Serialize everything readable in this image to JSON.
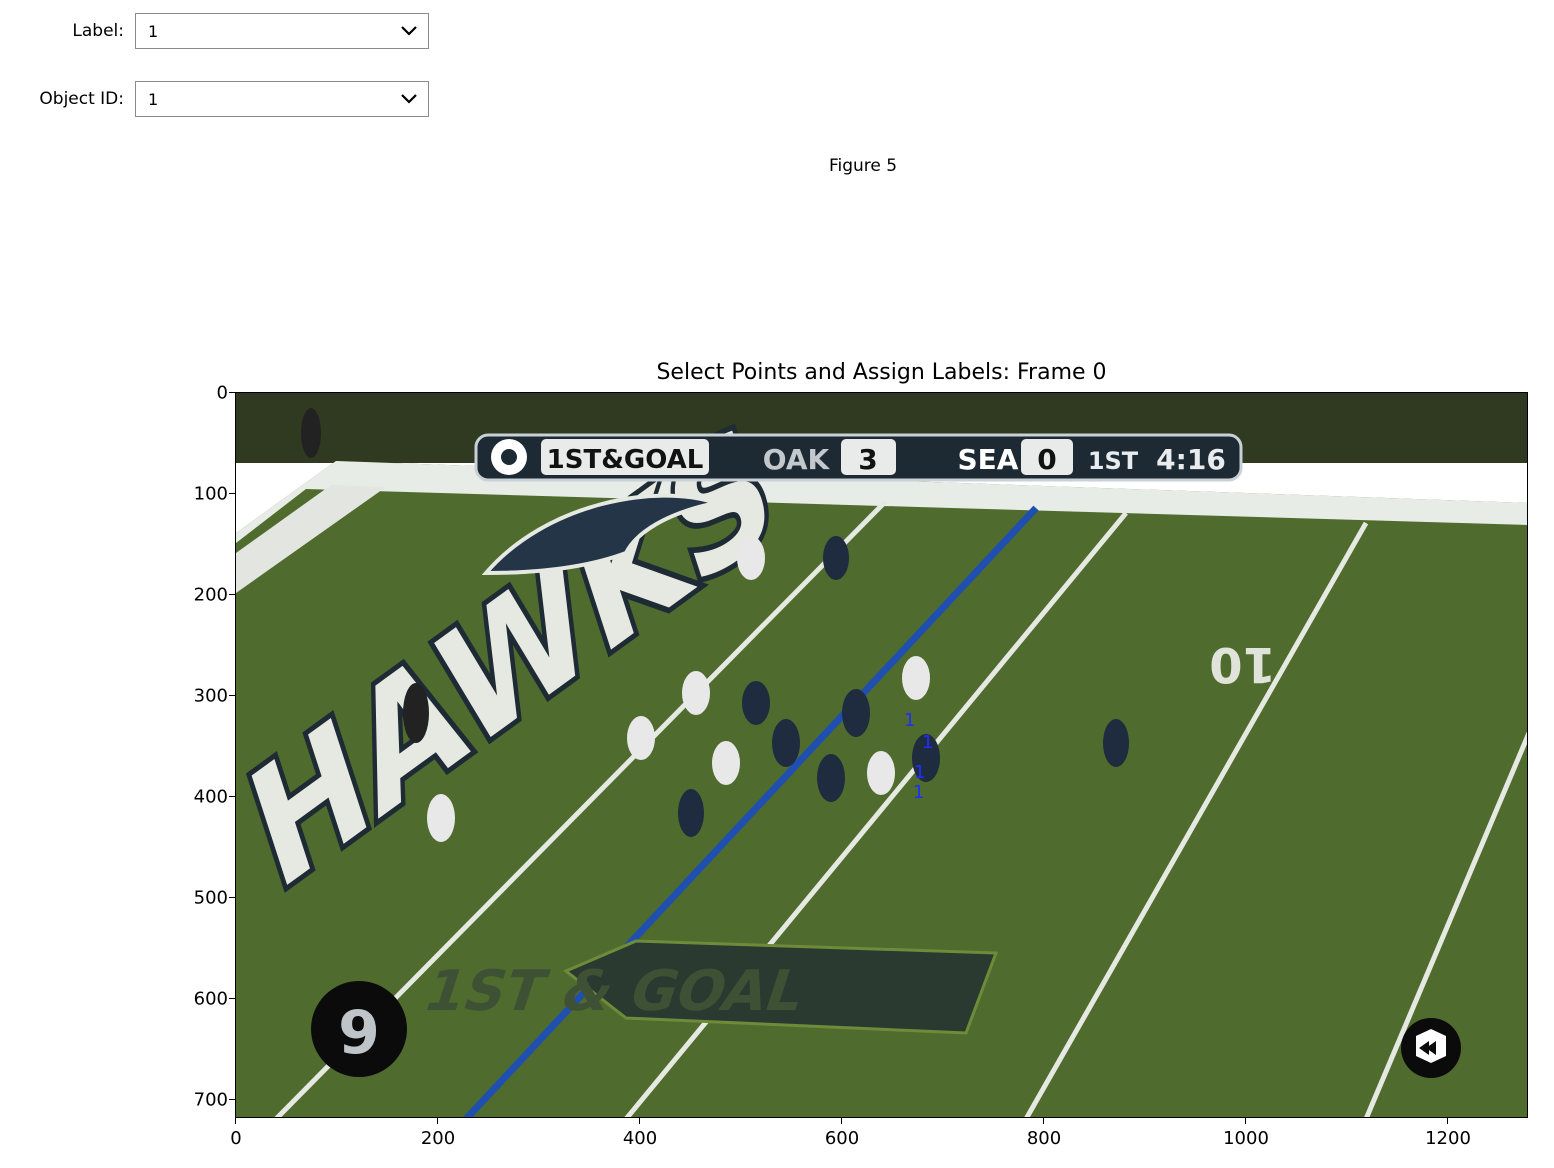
{
  "controls": {
    "label": {
      "caption": "Label:",
      "value": "1"
    },
    "object_id": {
      "caption": "Object ID:",
      "value": "1"
    }
  },
  "figure": {
    "label": "Figure 5",
    "title": "Select Points and Assign Labels: Frame 0",
    "y_ticks": [
      "0",
      "100",
      "200",
      "300",
      "400",
      "500",
      "600",
      "700"
    ],
    "x_ticks": [
      "0",
      "200",
      "400",
      "600",
      "800",
      "1000",
      "1200"
    ]
  },
  "scene": {
    "scoreboard": {
      "down": "1ST&GOAL",
      "away": "OAK",
      "away_score": "3",
      "home": "SEA",
      "home_score": "0",
      "quarter": "1ST",
      "clock": "4:16"
    },
    "field_text": "1ST & GOAL",
    "endzone_text": "HAWKS",
    "yard_marker": "10",
    "channel_badge": "9",
    "point_label": "1"
  },
  "colors": {
    "field": "#4f6b2e",
    "field_dark": "#3f5a24",
    "sideline": "#2f3a20",
    "first_down_line": "#1f4fb0",
    "point_marker": "#1f2fff"
  }
}
